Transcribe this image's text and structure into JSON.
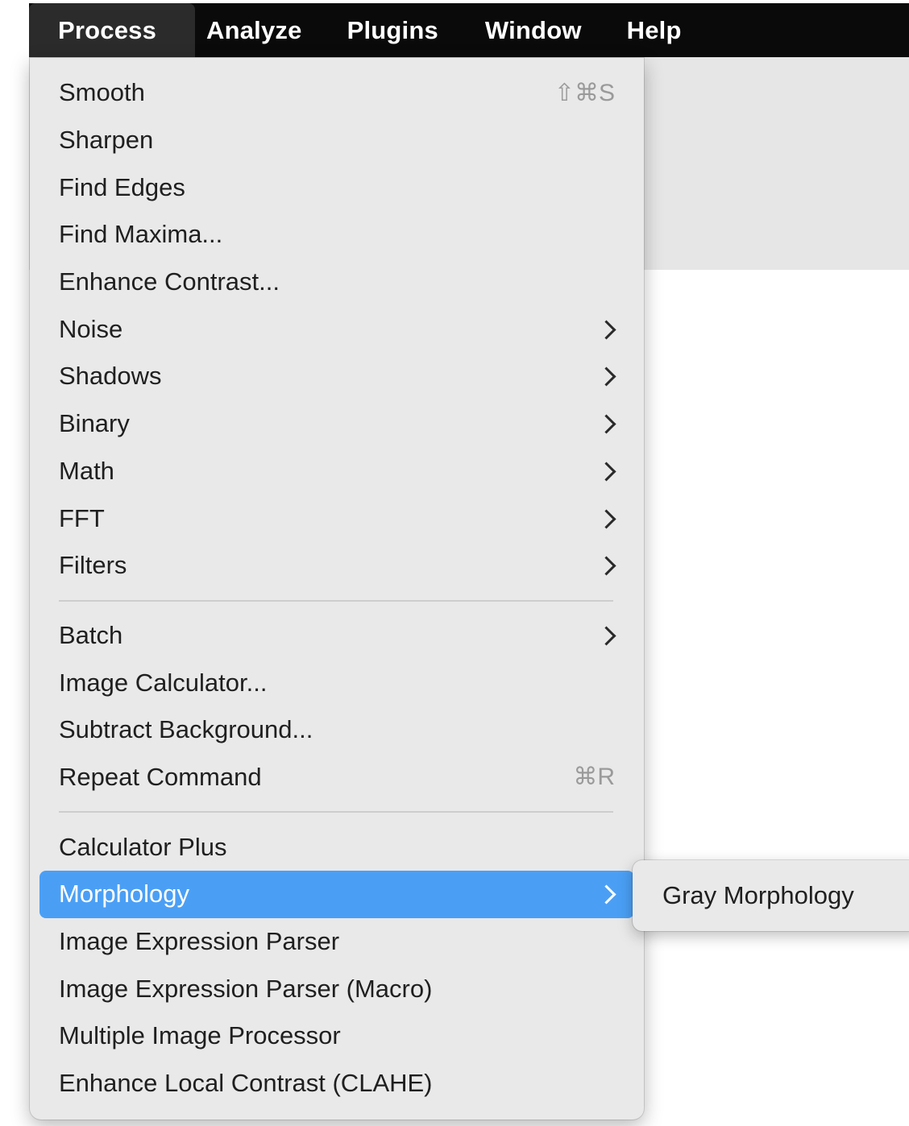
{
  "menubar": {
    "items": [
      {
        "label": "Process",
        "active": true
      },
      {
        "label": "Analyze"
      },
      {
        "label": "Plugins"
      },
      {
        "label": "Window"
      },
      {
        "label": "Help"
      }
    ]
  },
  "menu": {
    "items": [
      {
        "label": "Smooth",
        "shortcut": "⇧⌘S"
      },
      {
        "label": "Sharpen"
      },
      {
        "label": "Find Edges"
      },
      {
        "label": "Find Maxima..."
      },
      {
        "label": "Enhance Contrast..."
      },
      {
        "label": "Noise",
        "submenu": true
      },
      {
        "label": "Shadows",
        "submenu": true
      },
      {
        "label": "Binary",
        "submenu": true
      },
      {
        "label": "Math",
        "submenu": true
      },
      {
        "label": "FFT",
        "submenu": true
      },
      {
        "label": "Filters",
        "submenu": true
      },
      {
        "label": "Batch",
        "submenu": true
      },
      {
        "label": "Image Calculator..."
      },
      {
        "label": "Subtract Background..."
      },
      {
        "label": "Repeat Command",
        "shortcut": "⌘R"
      },
      {
        "label": "Calculator Plus"
      },
      {
        "label": "Morphology",
        "submenu": true,
        "highlighted": true
      },
      {
        "label": "Image Expression Parser"
      },
      {
        "label": "Image Expression Parser (Macro)"
      },
      {
        "label": "Multiple Image Processor"
      },
      {
        "label": "Enhance Local Contrast (CLAHE)"
      }
    ]
  },
  "submenu": {
    "items": [
      {
        "label": "Gray Morphology"
      }
    ]
  },
  "colors": {
    "highlight": "#4a9ff5",
    "menubar": "#0a0a0a",
    "menu_bg": "#e9e9e9"
  }
}
